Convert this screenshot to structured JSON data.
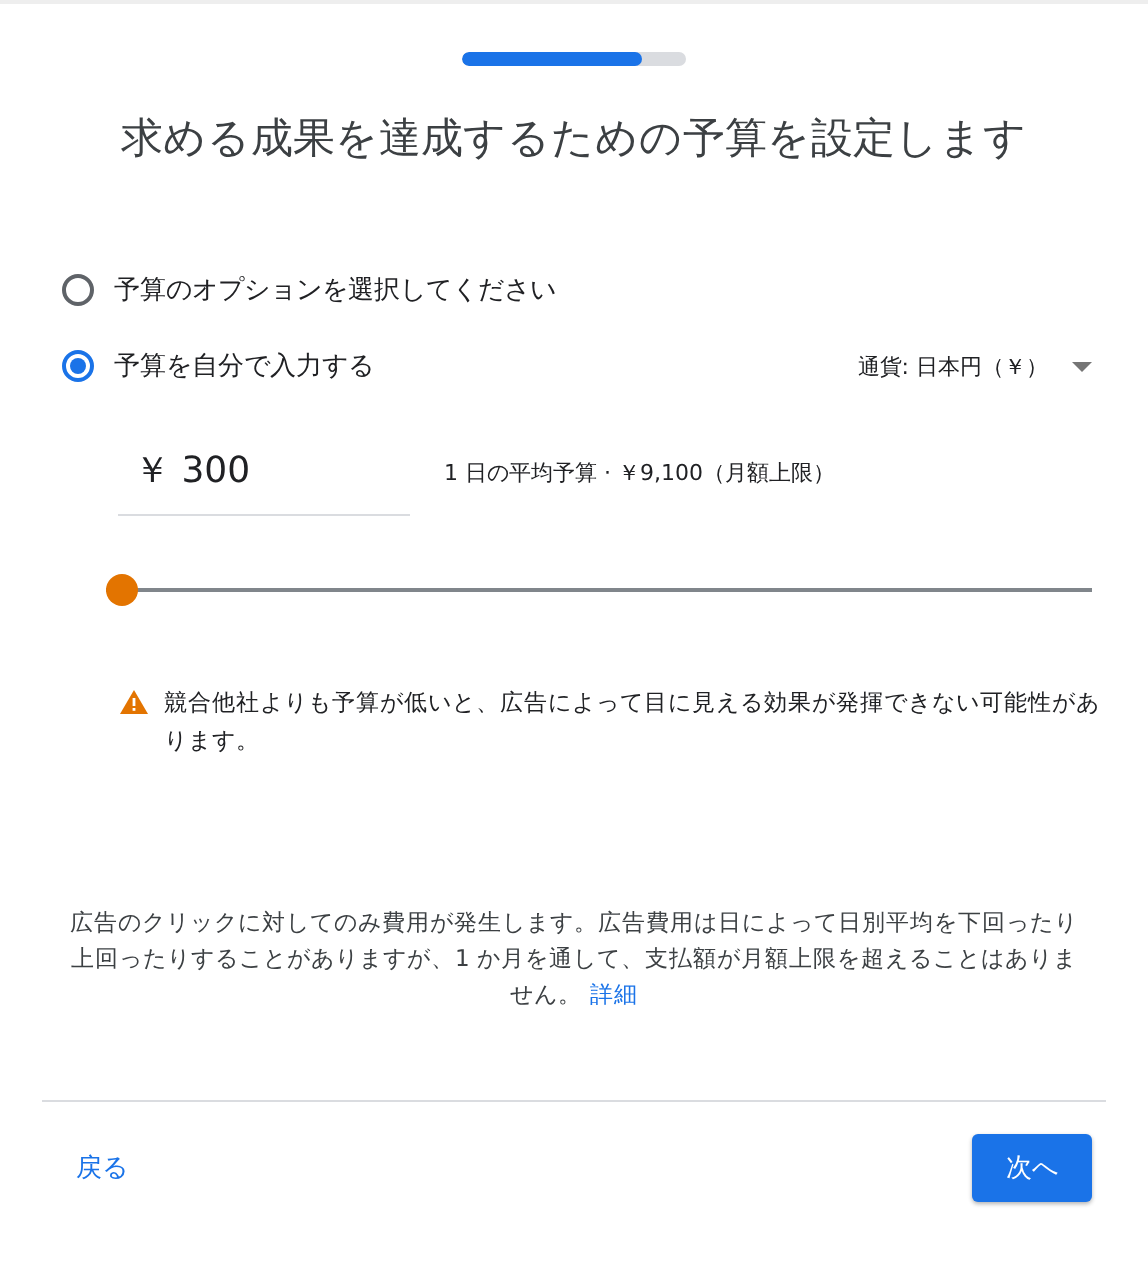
{
  "progress": {
    "level": 0.8
  },
  "title": "求める成果を達成するための予算を設定します",
  "options": [
    {
      "label": "予算のオプションを選択してください",
      "selected": false
    },
    {
      "label": "予算を自分で入力する",
      "selected": true
    }
  ],
  "currency": {
    "label": "通貨: 日本円（￥）"
  },
  "budget": {
    "value": "￥ 300",
    "daily_note": "1 日の平均予算 · ￥9,100（月額上限）"
  },
  "slider": {
    "level": 0
  },
  "warning": "競合他社よりも予算が低いと、広告によって目に見える効果が発揮できない可能性があります。",
  "disclaimer": {
    "text": "広告のクリックに対してのみ費用が発生します。広告費用は日によって日別平均を下回ったり上回ったりすることがありますが、1 か月を通して、支払額が月額上限を超えることはありません。",
    "link": "詳細"
  },
  "buttons": {
    "back": "戻る",
    "next": "次へ"
  }
}
